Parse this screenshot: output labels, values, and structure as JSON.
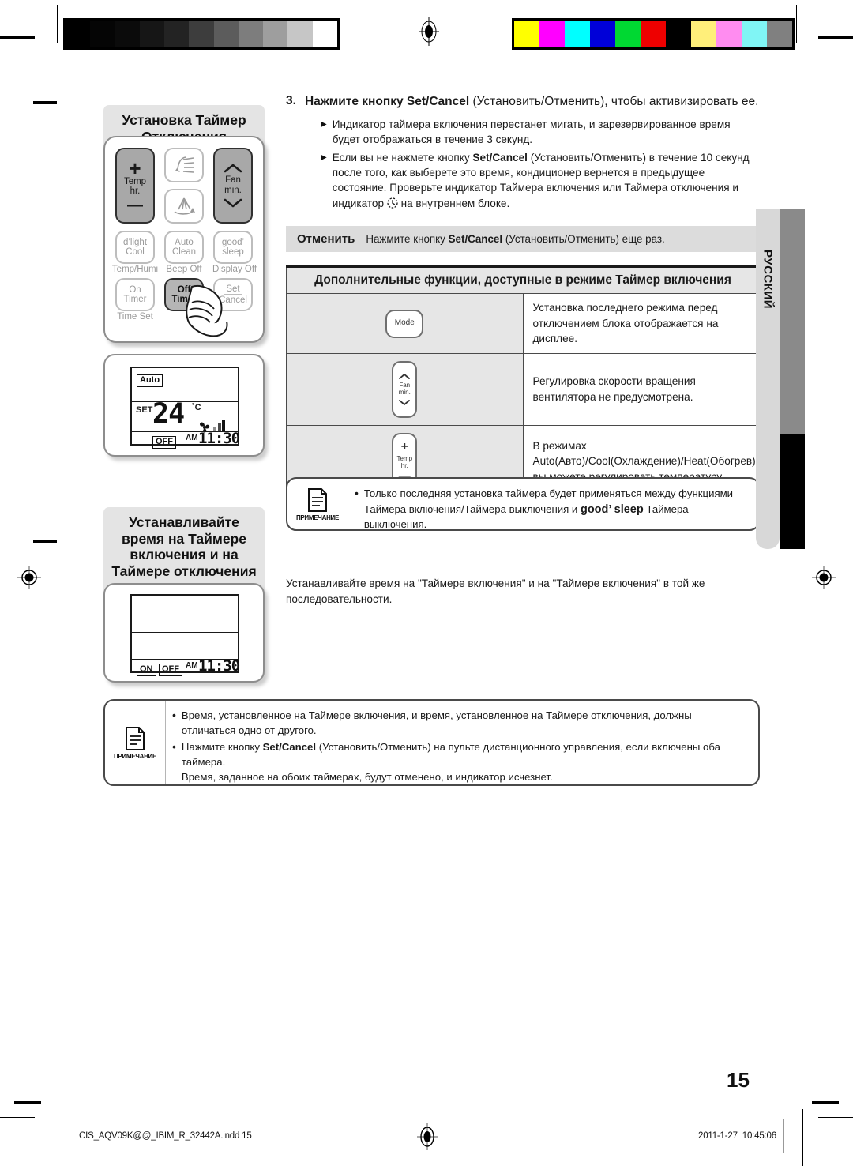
{
  "calibration": {
    "gray_steps": [
      "#000000",
      "#050505",
      "#0b0b0b",
      "#161616",
      "#232323",
      "#3d3d3d",
      "#5c5c5c",
      "#7d7d7d",
      "#9e9e9e",
      "#c6c6c6",
      "#ffffff"
    ],
    "color_steps": [
      "#ffff00",
      "#ff00ff",
      "#00ffff",
      "#0000d8",
      "#00d832",
      "#ee0000",
      "#000000",
      "#ffef7a",
      "#ff8cf0",
      "#80f5f5",
      "#808080"
    ]
  },
  "left": {
    "section1_title": "Установка Таймер Отключения",
    "remote": {
      "temp_button": {
        "plus": "+",
        "line1": "Temp",
        "line2": "hr.",
        "minus": "—"
      },
      "fan_button": {
        "up": "chevron-up",
        "line1": "Fan",
        "line2": "min.",
        "down": "chevron-down"
      },
      "swing_up_icon": "air-swing-up-icon",
      "swing_down_icon": "air-swing-down-icon",
      "buttons": [
        {
          "line1": "d’light",
          "line2": "Cool",
          "sub": "Temp/Humi"
        },
        {
          "line1": "Auto",
          "line2": "Clean",
          "sub": "Beep Off"
        },
        {
          "line1": "good’",
          "line2": "sleep",
          "sub": "Display Off"
        },
        {
          "line1": "On",
          "line2": "Timer",
          "sub": "Time Set"
        },
        {
          "line1": "Off",
          "line2": "Timer",
          "sub": ""
        },
        {
          "line1": "Set",
          "line2": "Cancel",
          "sub": ""
        }
      ],
      "pressed_button": "Off Timer"
    },
    "lcd1": {
      "mode": "Auto",
      "set_label": "SET",
      "temp": "24",
      "unit": "˚C",
      "fan_icon": "fan-icon",
      "fan_bars": 3,
      "timer_label": "OFF",
      "meridiem": "AM",
      "time": "11:30"
    },
    "section2_title": "Устанавливайте время на Таймере включения и на Таймере отключения вместе",
    "lcd2": {
      "on_label": "ON",
      "off_label": "OFF",
      "meridiem": "AM",
      "time": "11:30"
    }
  },
  "right": {
    "step": {
      "number": "3.",
      "head_a": "Нажмите кнопку ",
      "head_b": "Set/Cancel",
      "head_c": " (Установить/Отменить), чтобы активизировать ее.",
      "bullets": [
        "Индикатор таймера включения перестанет мигать, и зарезервированное время будет отображаться в течение 3 секунд."
      ],
      "bullet2": {
        "a": "Если вы не нажмете кнопку ",
        "b": "Set/Cancel",
        "c": " (Установить/Отменить) в течение 10 секунд после того, как выберете это время, кондиционер вернется в предыдущее состояние. Проверьте индикатор Таймера включения или Таймера отключения и индикатор ",
        "icon": "clock-icon",
        "d": " на внутреннем блоке."
      }
    },
    "cancel_row": {
      "label": "Отменить",
      "text_a": "Нажмите  кнопку ",
      "text_b": "Set/Cancel",
      "text_c": " (Установить/Отменить) еще раз."
    },
    "table": {
      "header": "Дополнительные функции, доступные в режиме Таймер включения",
      "rows": [
        {
          "icon": "mode-button-icon",
          "icon_label": "Mode",
          "text": "Установка последнего режима перед отключением блока отображается на дисплее."
        },
        {
          "icon": "fan-button-icon",
          "icon_l1": "Fan",
          "icon_l2": "min.",
          "text": "Регулировка скорости вращения вентилятора не предусмотрена."
        },
        {
          "icon": "temp-button-icon",
          "icon_l1": "Temp",
          "icon_l2": "hr.",
          "text": "В режимах  Auto(Авто)/Cool(Охлаждение)/Heat(Обогрев) вы можете регулировать температуру."
        }
      ]
    },
    "note1": {
      "caption": "ПРИМЕЧАНИЕ",
      "item_a": "Только последняя установка таймера будет применяться между функциями Таймера включения/Таймера выключения и ",
      "item_b": "good’ sleep",
      "item_c": " Таймера выключения."
    },
    "plain_text": "Устанавливайте время на \"Таймере включения\" и на \"Таймере включения\" в той же последовательности.",
    "note2": {
      "caption": "ПРИМЕЧАНИЕ",
      "item1": "Время, установленное на Таймере включения, и время, установленное на Таймере отключения, должны отличаться одно от другого.",
      "item2_a": "Нажмите кнопку ",
      "item2_b": "Set/Cancel",
      "item2_c": " (Установить/Отменить) на пульте дистанционного управления, если включены оба таймера.",
      "item2_d": "Время, заданное на обоих таймерах, будут отменено, и индикатор исчезнет."
    },
    "language_tab": "РУССКИЙ"
  },
  "footer": {
    "page_number": "15",
    "filename": "CIS_AQV09K@@_IBIM_R_32442A.indd   15",
    "date": "2011-1-27",
    "time": "10:45:06"
  }
}
